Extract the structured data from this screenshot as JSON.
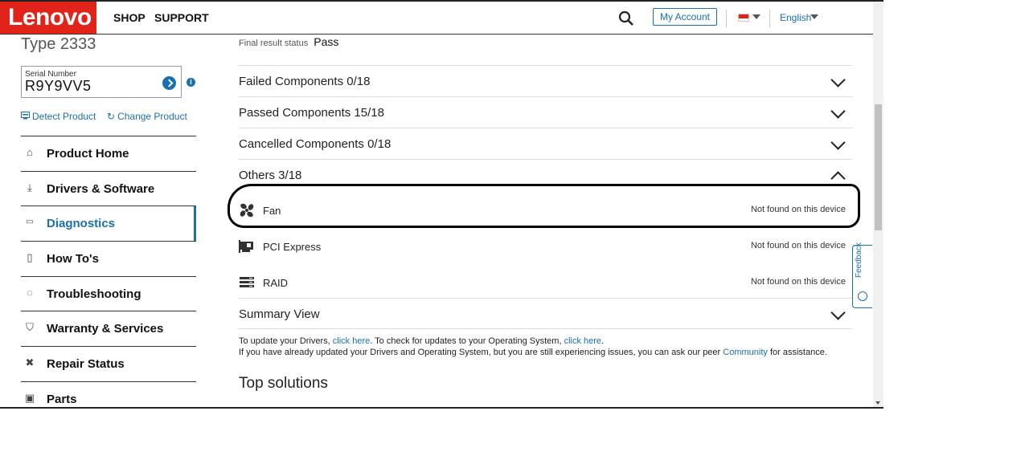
{
  "header": {
    "logo": "Lenovo",
    "nav": [
      "SHOP",
      "SUPPORT"
    ],
    "account_label": "My Account",
    "language": "English"
  },
  "sidebar": {
    "type_label": "Type 2333",
    "serial_label": "Serial Number",
    "serial_value": "R9Y9VV5",
    "detect_label": "Detect Product",
    "change_label": "Change Product",
    "menu": [
      {
        "label": "Product Home",
        "icon": "home-icon"
      },
      {
        "label": "Drivers & Software",
        "icon": "download-icon"
      },
      {
        "label": "Diagnostics",
        "icon": "diagnostics-icon",
        "active": true
      },
      {
        "label": "How To's",
        "icon": "book-icon"
      },
      {
        "label": "Troubleshooting",
        "icon": "share-icon"
      },
      {
        "label": "Warranty & Services",
        "icon": "shield-icon"
      },
      {
        "label": "Repair Status",
        "icon": "tools-icon"
      },
      {
        "label": "Parts",
        "icon": "chip-icon"
      }
    ]
  },
  "main": {
    "result_status_label": "Final result status",
    "result_status_value": "Pass",
    "sections": {
      "failed": "Failed Components 0/18",
      "passed": "Passed Components 15/18",
      "cancelled": "Cancelled Components 0/18",
      "others": "Others 3/18",
      "summary": "Summary View"
    },
    "components": [
      {
        "name": "Fan",
        "status": "Not found on this device",
        "icon": "fan-icon"
      },
      {
        "name": "PCI Express",
        "status": "Not found on this device",
        "icon": "pci-card-icon"
      },
      {
        "name": "RAID",
        "status": "Not found on this device",
        "icon": "raid-icon"
      }
    ],
    "info": {
      "line1_a": "To update your Drivers, ",
      "link1": "click here",
      "line1_b": ". To check for updates to your Operating System, ",
      "link2": "click here",
      "line1_c": ".",
      "line2_a": "If you have already updated your Drivers and Operating System, but you are still experiencing issues, you can ask our peer ",
      "link3": "Community",
      "line2_b": " for assistance."
    },
    "top_solutions": "Top solutions"
  },
  "feedback_label": "Feedback",
  "colors": {
    "brand": "#e2231a",
    "accent": "#1a6fb0"
  }
}
